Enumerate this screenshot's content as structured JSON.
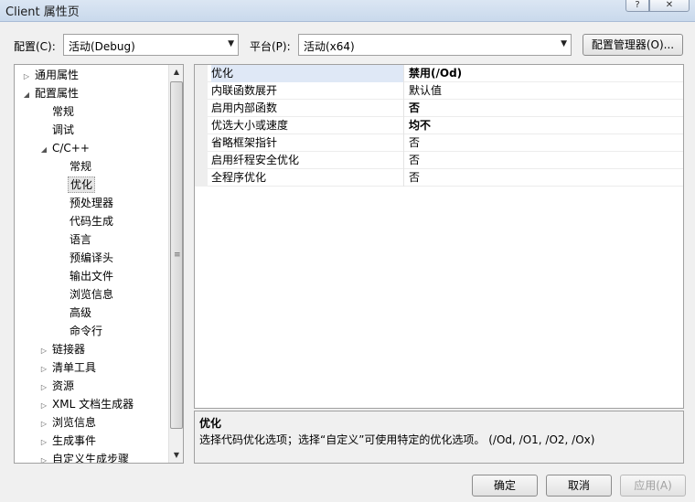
{
  "window": {
    "title": "Client 属性页",
    "help_glyph": "?",
    "close_glyph": "✕"
  },
  "toolbar": {
    "config_label": "配置(C):",
    "config_value": "活动(Debug)",
    "platform_label": "平台(P):",
    "platform_value": "活动(x64)",
    "config_manager_button": "配置管理器(O)..."
  },
  "tree": {
    "items": [
      {
        "label": "通用属性",
        "expander": "▷"
      },
      {
        "label": "配置属性",
        "expander": "◢"
      },
      {
        "label": "常规",
        "expander": ""
      },
      {
        "label": "调试",
        "expander": ""
      },
      {
        "label": "C/C++",
        "expander": "◢"
      },
      {
        "label": "常规",
        "expander": ""
      },
      {
        "label": "优化",
        "expander": ""
      },
      {
        "label": "预处理器",
        "expander": ""
      },
      {
        "label": "代码生成",
        "expander": ""
      },
      {
        "label": "语言",
        "expander": ""
      },
      {
        "label": "预编译头",
        "expander": ""
      },
      {
        "label": "输出文件",
        "expander": ""
      },
      {
        "label": "浏览信息",
        "expander": ""
      },
      {
        "label": "高级",
        "expander": ""
      },
      {
        "label": "命令行",
        "expander": ""
      },
      {
        "label": "链接器",
        "expander": "▷"
      },
      {
        "label": "清单工具",
        "expander": "▷"
      },
      {
        "label": "资源",
        "expander": "▷"
      },
      {
        "label": "XML 文档生成器",
        "expander": "▷"
      },
      {
        "label": "浏览信息",
        "expander": "▷"
      },
      {
        "label": "生成事件",
        "expander": "▷"
      },
      {
        "label": "自定义生成步骤",
        "expander": "▷"
      }
    ],
    "selected_index": 6,
    "scroll_up": "▲",
    "scroll_down": "▼",
    "scroll_grip": "≡"
  },
  "properties": {
    "rows": [
      {
        "name": "优化",
        "value": "禁用(/Od)",
        "bold": true
      },
      {
        "name": "内联函数展开",
        "value": "默认值",
        "bold": false
      },
      {
        "name": "启用内部函数",
        "value": "否",
        "bold": true
      },
      {
        "name": "优选大小或速度",
        "value": "均不",
        "bold": true
      },
      {
        "name": "省略框架指针",
        "value": "否",
        "bold": false
      },
      {
        "name": "启用纤程安全优化",
        "value": "否",
        "bold": false
      },
      {
        "name": "全程序优化",
        "value": "否",
        "bold": false
      }
    ],
    "selected_index": 0
  },
  "description": {
    "title": "优化",
    "text": "选择代码优化选项；选择“自定义”可使用特定的优化选项。     (/Od, /O1, /O2, /Ox)"
  },
  "buttons": {
    "ok": "确定",
    "cancel": "取消",
    "apply": "应用(A)"
  }
}
